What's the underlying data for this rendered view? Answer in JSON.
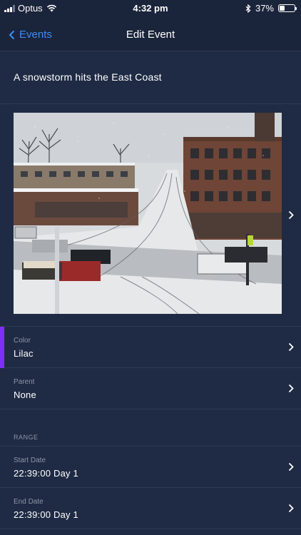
{
  "status_bar": {
    "carrier": "Optus",
    "time": "4:32 pm",
    "battery_percent": "37%",
    "battery_level": 0.37,
    "icons": [
      "signal-icon",
      "wifi-icon",
      "bluetooth-icon",
      "battery-icon"
    ]
  },
  "nav": {
    "back_label": "Events",
    "title": "Edit Event"
  },
  "event": {
    "title": "A snowstorm hits the East Coast",
    "photo_alt": "Snowy street scene"
  },
  "fields": {
    "color": {
      "label": "Color",
      "value": "Lilac",
      "accent": "#7b2ff7"
    },
    "parent": {
      "label": "Parent",
      "value": "None"
    }
  },
  "range": {
    "section_label": "RANGE",
    "start": {
      "label": "Start Date",
      "value": "22:39:00 Day 1"
    },
    "end": {
      "label": "End Date",
      "value": "22:39:00 Day 1"
    }
  },
  "colors": {
    "background": "#1f2b44",
    "header": "#1a243a",
    "link": "#3d8ff5",
    "divider": "#2e3a55"
  }
}
